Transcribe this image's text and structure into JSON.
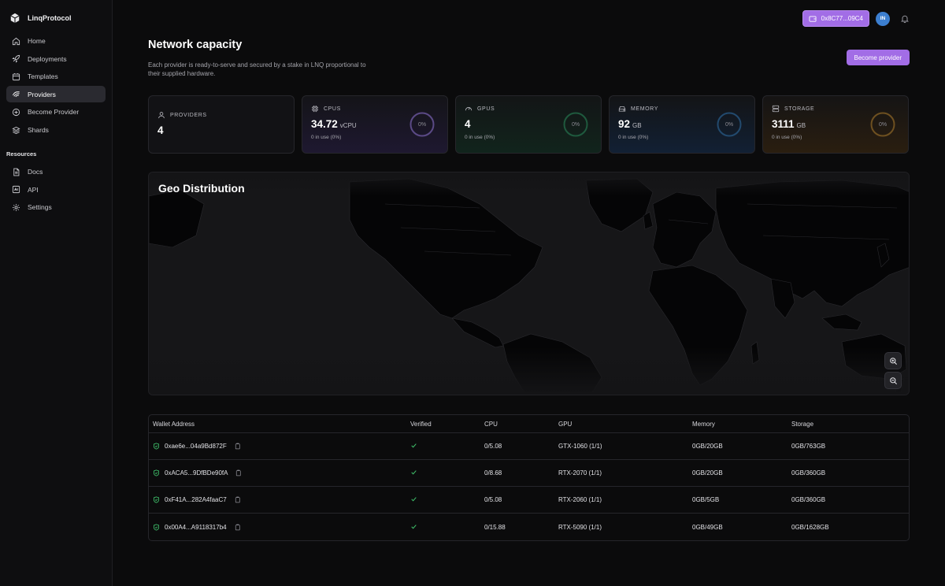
{
  "brand": {
    "name": "LinqProtocol"
  },
  "sidebar": {
    "items": [
      {
        "label": "Home",
        "icon": "home-icon"
      },
      {
        "label": "Deployments",
        "icon": "rocket-icon"
      },
      {
        "label": "Templates",
        "icon": "template-icon"
      },
      {
        "label": "Providers",
        "icon": "providers-icon",
        "active": true
      },
      {
        "label": "Become Provider",
        "icon": "plus-circle-icon"
      },
      {
        "label": "Shards",
        "icon": "layers-icon"
      }
    ],
    "section_title": "Resources",
    "resources": [
      {
        "label": "Docs",
        "icon": "doc-icon"
      },
      {
        "label": "API",
        "icon": "api-icon"
      },
      {
        "label": "Settings",
        "icon": "gear-icon"
      }
    ]
  },
  "topbar": {
    "wallet": "0x8C77...09C4",
    "avatar": "IN"
  },
  "header": {
    "title": "Network capacity",
    "description": "Each provider is ready-to-serve and secured by a stake in LNQ proportional to their supplied hardware.",
    "become_button": "Become provider"
  },
  "stats": {
    "providers": {
      "label": "PROVIDERS",
      "value": "4"
    },
    "cpus": {
      "label": "CPUS",
      "value": "34.72",
      "unit": "vCPU",
      "usage": "0 in use (0%)",
      "percent": "0%"
    },
    "gpus": {
      "label": "GPUS",
      "value": "4",
      "unit": "",
      "usage": "0 in use (0%)",
      "percent": "0%"
    },
    "memory": {
      "label": "MEMORY",
      "value": "92",
      "unit": "GB",
      "usage": "0 in use (0%)",
      "percent": "0%"
    },
    "storage": {
      "label": "STORAGE",
      "value": "3111",
      "unit": "GB",
      "usage": "0 in use (0%)",
      "percent": "0%"
    }
  },
  "colors": {
    "accent": "#a26de6",
    "cpu": "#8b6dd8",
    "gpu": "#2fa56b",
    "memory": "#3b82c4",
    "storage": "#c98a2a"
  },
  "map": {
    "title": "Geo Distribution"
  },
  "table": {
    "headers": [
      "Wallet Address",
      "Verified",
      "CPU",
      "GPU",
      "Memory",
      "Storage"
    ],
    "rows": [
      {
        "wallet": "0xae6e...04a9Bd872F",
        "cpu": "0/5.08",
        "gpu": "GTX-1060 (1/1)",
        "memory": "0GB/20GB",
        "storage": "0GB/763GB"
      },
      {
        "wallet": "0xACA5...9DfBDe90fA",
        "cpu": "0/8.68",
        "gpu": "RTX-2070 (1/1)",
        "memory": "0GB/20GB",
        "storage": "0GB/360GB"
      },
      {
        "wallet": "0xF41A...282A4faaC7",
        "cpu": "0/5.08",
        "gpu": "RTX-2060 (1/1)",
        "memory": "0GB/5GB",
        "storage": "0GB/360GB"
      },
      {
        "wallet": "0x00A4...A9118317b4",
        "cpu": "0/15.88",
        "gpu": "RTX-5090 (1/1)",
        "memory": "0GB/49GB",
        "storage": "0GB/1628GB"
      }
    ]
  }
}
